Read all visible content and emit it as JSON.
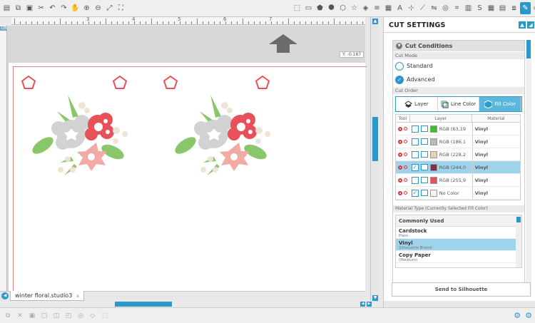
{
  "toolbar": {
    "left_icons": [
      "save-icon",
      "copy-icon",
      "paste-icon",
      "cut-icon",
      "undo-icon",
      "redo-icon",
      "pan-icon",
      "zoom-in-icon",
      "zoom-out-icon",
      "zoom-fit-icon",
      "zoom-select-icon"
    ],
    "right_icons": [
      "select-icon",
      "page-setup-icon",
      "pentagon-icon",
      "octagon-icon",
      "hexagon-icon",
      "star-icon",
      "shape-icon",
      "line-style-icon",
      "fill-icon",
      "text-icon",
      "point-edit-icon",
      "knife-icon",
      "mirror-icon",
      "offset-icon",
      "trace-icon",
      "library-icon",
      "store-icon",
      "grid-icon",
      "align-icon",
      "replicate-icon",
      "send-icon",
      "design-icon"
    ]
  },
  "ruler": {
    "numbers": [
      "3",
      "4",
      "5",
      "6",
      "7"
    ],
    "units_label": "LINES"
  },
  "canvas": {
    "coords": "Y: -0.187"
  },
  "document_tab": {
    "name": "winter floral.studio3",
    "close": "x"
  },
  "panel": {
    "title": "CUT SETTINGS",
    "section_title": "Cut Conditions",
    "cut_mode_label": "Cut Mode",
    "mode_standard": "Standard",
    "mode_advanced": "Advanced",
    "cut_order_label": "Cut Order",
    "order_layer": "Layer",
    "order_line": "Line Color",
    "order_fill": "Fill Color",
    "col_tool": "Tool",
    "col_layer": "Layer",
    "col_material": "Material",
    "rows": [
      {
        "label": "RGB (63,19",
        "color": "#3fbf2a",
        "material": "Vinyl",
        "checked": false
      },
      {
        "label": "RGB (186,1",
        "color": "#b9b9b9",
        "material": "Vinyl",
        "checked": false
      },
      {
        "label": "RGB (228,2",
        "color": "#e4d1b8",
        "material": "Vinyl",
        "checked": false
      },
      {
        "label": "RGB (244,0",
        "color": "#7d2d4e",
        "material": "Vinyl",
        "checked": true
      },
      {
        "label": "RGB (255,9",
        "color": "#e8505a",
        "material": "Vinyl",
        "checked": false
      },
      {
        "label": "No Color",
        "color": "none",
        "material": "Vinyl",
        "checked": true
      }
    ],
    "material_type_label": "Material Type (Currently Selected Fill Color)",
    "material_group": "Commonly Used",
    "materials": [
      {
        "name": "Cardstock",
        "sub": "Plain"
      },
      {
        "name": "Vinyl",
        "sub": "Silhouette Brand"
      },
      {
        "name": "Copy Paper",
        "sub": "(Medium)"
      }
    ],
    "send_button": "Send to Silhouette"
  },
  "colors": {
    "accent": "#2a98c9",
    "flower_red": "#e8505a",
    "flower_pink": "#f2aba4",
    "flower_grey": "#d2d2d2",
    "leaf_green": "#89c76a",
    "berry": "#efe3d6"
  }
}
